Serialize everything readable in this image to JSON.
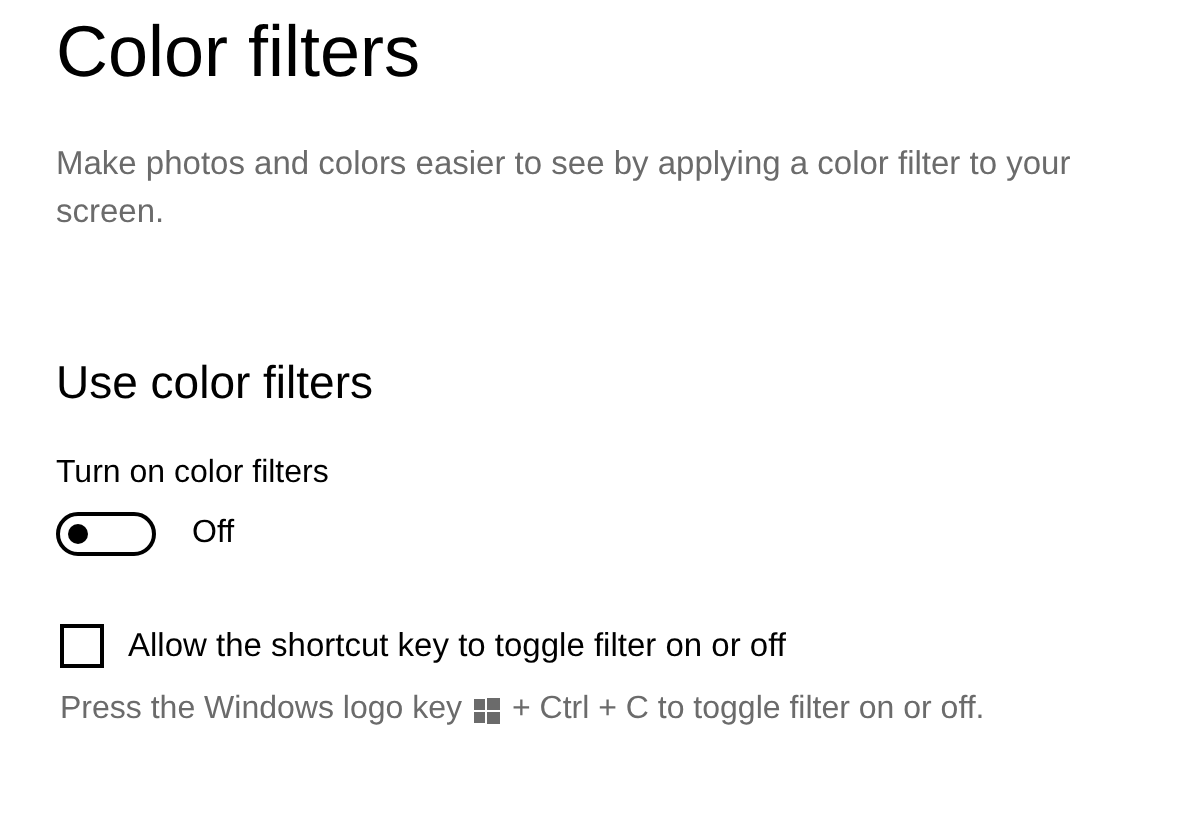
{
  "title": "Color filters",
  "description": "Make photos and colors easier to see by applying a color filter to your screen.",
  "section": {
    "heading": "Use color filters",
    "toggle": {
      "label": "Turn on color filters",
      "on": false,
      "state_text": "Off"
    },
    "checkbox": {
      "label": "Allow the shortcut key to toggle filter on or off",
      "checked": false
    },
    "hint_before": "Press the Windows logo key",
    "hint_after": "+ Ctrl + C to toggle filter on or off."
  }
}
